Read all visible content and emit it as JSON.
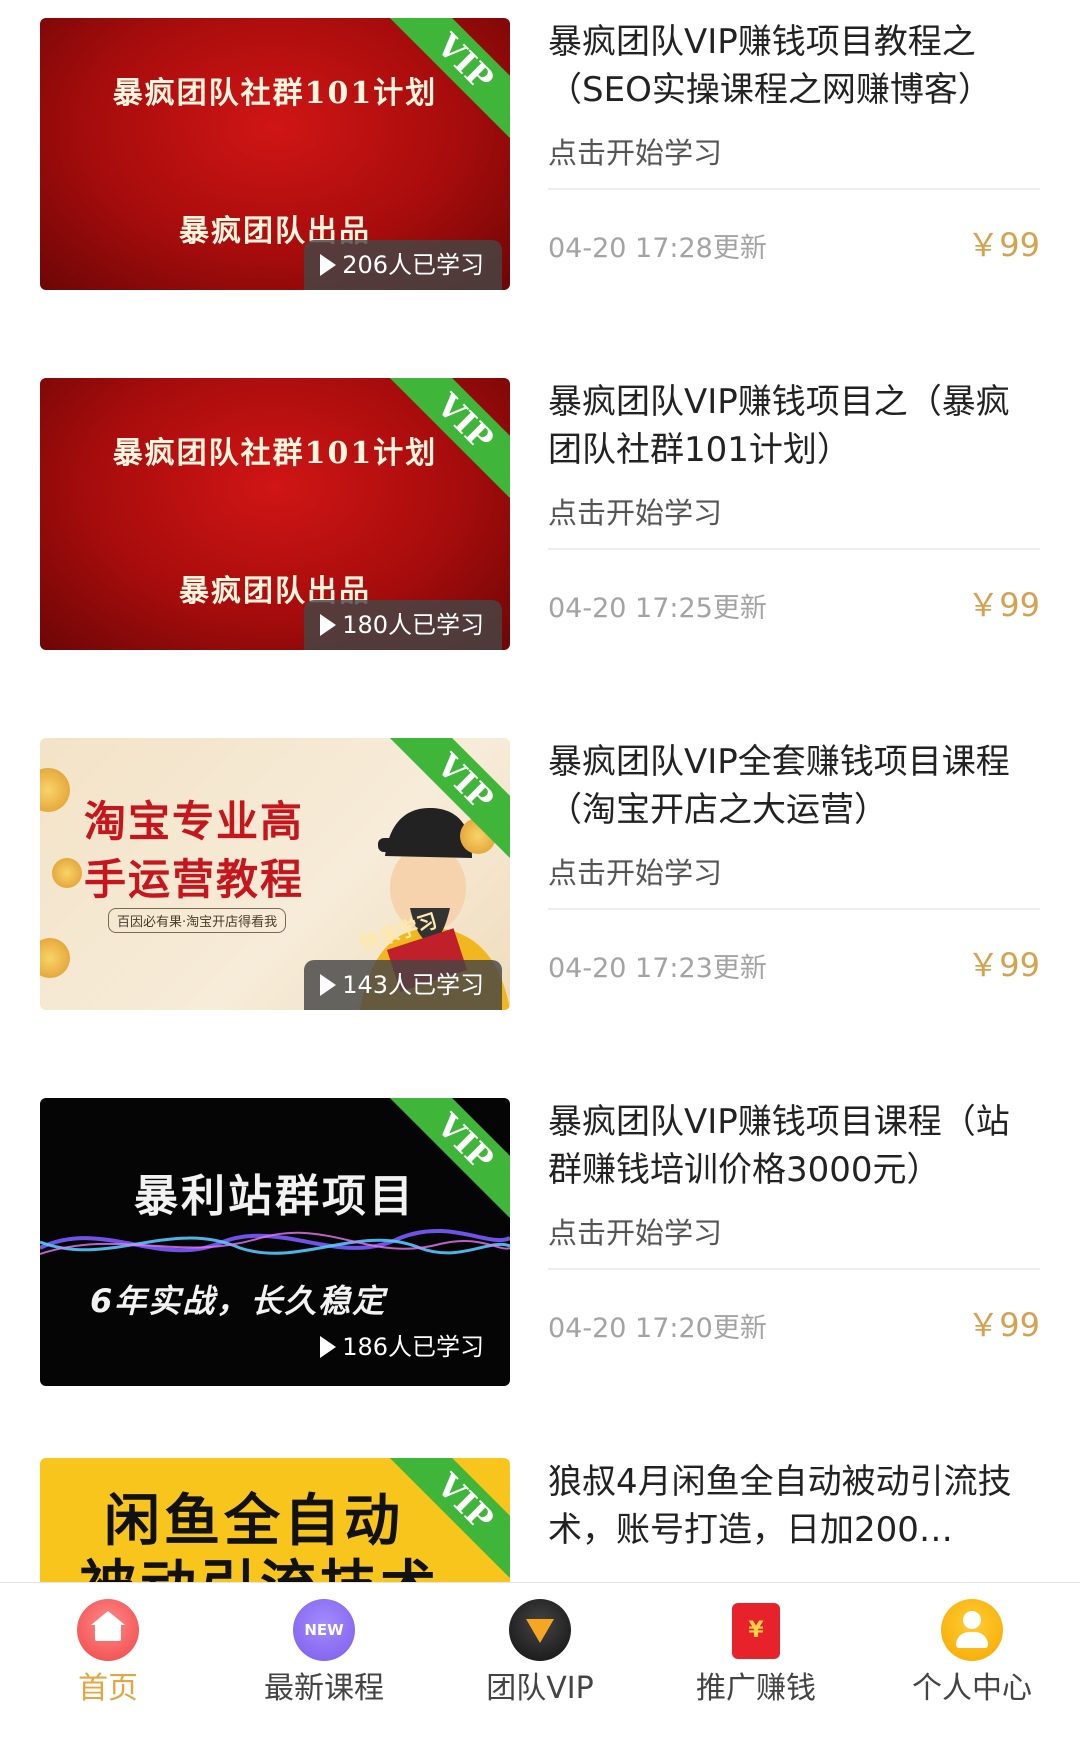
{
  "courses": [
    {
      "thumb_line1": "暴疯团队社群101计划",
      "thumb_line2": "暴疯团队出品",
      "vip_label": "VIP",
      "learners": "206人已学习",
      "title": "暴疯团队VIP赚钱项目教程之（SEO实操课程之网赚博客）",
      "cta": "点击开始学习",
      "updated": "04-20 17:28更新",
      "price": "￥99"
    },
    {
      "thumb_line1": "暴疯团队社群101计划",
      "thumb_line2": "暴疯团队出品",
      "vip_label": "VIP",
      "learners": "180人已学习",
      "title": "暴疯团队VIP赚钱项目之（暴疯团队社群101计划）",
      "cta": "点击开始学习",
      "updated": "04-20 17:25更新",
      "price": "￥99"
    },
    {
      "thumb_line1": "淘宝专业高",
      "thumb_line2": "手运营教程",
      "thumb_tag": "百因必有果·淘宝开店得看我",
      "thumb_book": "快来学习",
      "vip_label": "VIP",
      "learners": "143人已学习",
      "title": "暴疯团队VIP全套赚钱项目课程（淘宝开店之大运营）",
      "cta": "点击开始学习",
      "updated": "04-20 17:23更新",
      "price": "￥99"
    },
    {
      "thumb_line1": "暴利站群项目",
      "thumb_line2": "6年实战，长久稳定",
      "vip_label": "VIP",
      "learners": "186人已学习",
      "title": "暴疯团队VIP赚钱项目课程（站群赚钱培训价格3000元）",
      "cta": "点击开始学习",
      "updated": "04-20 17:20更新",
      "price": "￥99"
    },
    {
      "thumb_line1": "闲鱼全自动",
      "thumb_line2": "被动引流技术",
      "vip_label": "VIP",
      "title": "狼叔4月闲鱼全自动被动引流技术，账号打造，日加200…"
    }
  ],
  "tabbar": {
    "home": "首页",
    "new_icon": "NEW",
    "new_courses": "最新课程",
    "team_vip": "团队VIP",
    "promo_icon": "¥",
    "promote": "推广赚钱",
    "profile": "个人中心",
    "active_color": "#e5a542"
  }
}
